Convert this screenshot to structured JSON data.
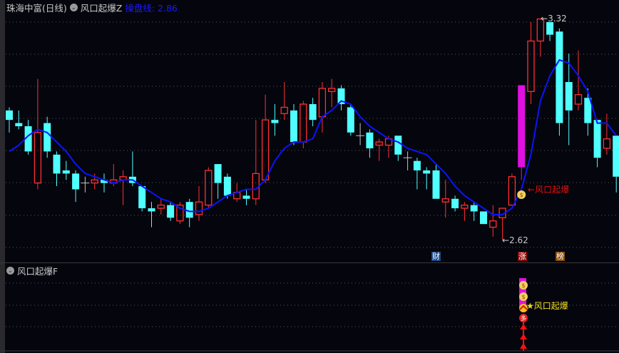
{
  "header": {
    "stock": "珠海中富(日线)",
    "indicator": "风口起爆Z",
    "line_label": "操盘线: 2.86"
  },
  "sub_header": {
    "indicator": "风口起爆F"
  },
  "annotations": {
    "high_label": "3.32",
    "low_label": "2.62",
    "signal_main": "风口起爆",
    "signal_sub": "★风口起爆",
    "tags": [
      {
        "text": "财",
        "color": "#1a4a8a"
      },
      {
        "text": "涨",
        "color": "#8a0a0a"
      },
      {
        "text": "榜",
        "color": "#8a4a0a"
      }
    ]
  },
  "colors": {
    "up": "#ff3030",
    "down": "#50ffff",
    "doji": "#c0c0c0",
    "ma": "#0a14ff",
    "signal": "#e010e0"
  },
  "chart_data": {
    "type": "candlestick",
    "ylim": [
      2.6,
      3.36
    ],
    "candles": [
      [
        3.03,
        3.04,
        2.96,
        3.0
      ],
      [
        2.99,
        3.03,
        2.97,
        2.98
      ],
      [
        2.98,
        3.0,
        2.89,
        2.9
      ],
      [
        2.8,
        3.13,
        2.78,
        2.96
      ],
      [
        2.99,
        3.01,
        2.88,
        2.9
      ],
      [
        2.89,
        2.9,
        2.79,
        2.83
      ],
      [
        2.84,
        2.87,
        2.81,
        2.83
      ],
      [
        2.83,
        2.84,
        2.74,
        2.78
      ],
      [
        2.8,
        2.82,
        2.77,
        2.8
      ],
      [
        2.8,
        2.83,
        2.78,
        2.81
      ],
      [
        2.81,
        2.83,
        2.77,
        2.8
      ],
      [
        2.8,
        2.86,
        2.79,
        2.81
      ],
      [
        2.81,
        2.84,
        2.73,
        2.82
      ],
      [
        2.82,
        2.9,
        2.79,
        2.8
      ],
      [
        2.79,
        2.79,
        2.71,
        2.72
      ],
      [
        2.72,
        2.74,
        2.66,
        2.71
      ],
      [
        2.72,
        2.75,
        2.7,
        2.73
      ],
      [
        2.73,
        2.74,
        2.68,
        2.69
      ],
      [
        2.68,
        2.74,
        2.67,
        2.73
      ],
      [
        2.74,
        2.75,
        2.66,
        2.69
      ],
      [
        2.7,
        2.79,
        2.68,
        2.74
      ],
      [
        2.73,
        2.85,
        2.72,
        2.84
      ],
      [
        2.86,
        2.86,
        2.75,
        2.8
      ],
      [
        2.82,
        2.83,
        2.75,
        2.76
      ],
      [
        2.75,
        2.8,
        2.74,
        2.77
      ],
      [
        2.76,
        2.78,
        2.73,
        2.75
      ],
      [
        2.75,
        3.0,
        2.73,
        2.83
      ],
      [
        2.81,
        3.08,
        2.8,
        3.0
      ],
      [
        3.0,
        3.05,
        2.95,
        2.99
      ],
      [
        3.02,
        3.12,
        3.0,
        3.04
      ],
      [
        3.03,
        3.05,
        2.92,
        2.93
      ],
      [
        2.93,
        3.06,
        2.91,
        3.05
      ],
      [
        3.05,
        3.07,
        2.98,
        3.0
      ],
      [
        3.01,
        3.12,
        2.96,
        3.1
      ],
      [
        3.09,
        3.13,
        3.04,
        3.1
      ],
      [
        3.1,
        3.11,
        3.03,
        3.05
      ],
      [
        3.04,
        3.05,
        2.95,
        2.96
      ],
      [
        2.95,
        2.99,
        2.92,
        2.95
      ],
      [
        2.96,
        2.97,
        2.88,
        2.91
      ],
      [
        2.92,
        2.94,
        2.87,
        2.93
      ],
      [
        2.92,
        2.95,
        2.88,
        2.94
      ],
      [
        2.95,
        2.95,
        2.87,
        2.89
      ],
      [
        2.88,
        2.9,
        2.84,
        2.88
      ],
      [
        2.87,
        2.88,
        2.78,
        2.84
      ],
      [
        2.84,
        2.85,
        2.78,
        2.83
      ],
      [
        2.84,
        2.86,
        2.75,
        2.75
      ],
      [
        2.74,
        2.81,
        2.69,
        2.75
      ],
      [
        2.75,
        2.76,
        2.71,
        2.72
      ],
      [
        2.72,
        2.74,
        2.68,
        2.73
      ],
      [
        2.73,
        2.74,
        2.68,
        2.71
      ],
      [
        2.71,
        2.71,
        2.67,
        2.67
      ],
      [
        2.66,
        2.73,
        2.63,
        2.68
      ],
      [
        2.69,
        2.72,
        2.62,
        2.72
      ],
      [
        2.73,
        2.83,
        2.73,
        2.82
      ],
      [
        2.85,
        3.11,
        2.81,
        3.11
      ],
      [
        3.09,
        3.31,
        3.05,
        3.25
      ],
      [
        3.25,
        3.32,
        3.2,
        3.32
      ],
      [
        3.31,
        3.31,
        3.25,
        3.27
      ],
      [
        3.28,
        3.29,
        2.95,
        2.99
      ],
      [
        3.12,
        3.21,
        2.92,
        3.03
      ],
      [
        3.05,
        3.22,
        3.03,
        3.08
      ],
      [
        3.07,
        3.1,
        2.95,
        2.99
      ],
      [
        3.0,
        3.0,
        2.85,
        2.88
      ],
      [
        2.91,
        3.02,
        2.89,
        2.94
      ],
      [
        2.95,
        2.95,
        2.77,
        2.82
      ]
    ],
    "signal_candle_index": 54,
    "ma": [
      2.9,
      2.92,
      2.95,
      2.97,
      2.96,
      2.93,
      2.9,
      2.86,
      2.83,
      2.82,
      2.81,
      2.8,
      2.81,
      2.81,
      2.79,
      2.77,
      2.75,
      2.74,
      2.72,
      2.71,
      2.71,
      2.72,
      2.74,
      2.76,
      2.77,
      2.78,
      2.78,
      2.81,
      2.87,
      2.91,
      2.93,
      2.93,
      2.94,
      3.01,
      3.03,
      3.06,
      3.05,
      3.01,
      2.98,
      2.96,
      2.94,
      2.93,
      2.91,
      2.9,
      2.89,
      2.86,
      2.83,
      2.79,
      2.76,
      2.74,
      2.72,
      2.7,
      2.7,
      2.72,
      2.78,
      2.89,
      3.06,
      3.14,
      3.19,
      3.18,
      3.14,
      3.09,
      2.99,
      2.99,
      2.95
    ]
  }
}
